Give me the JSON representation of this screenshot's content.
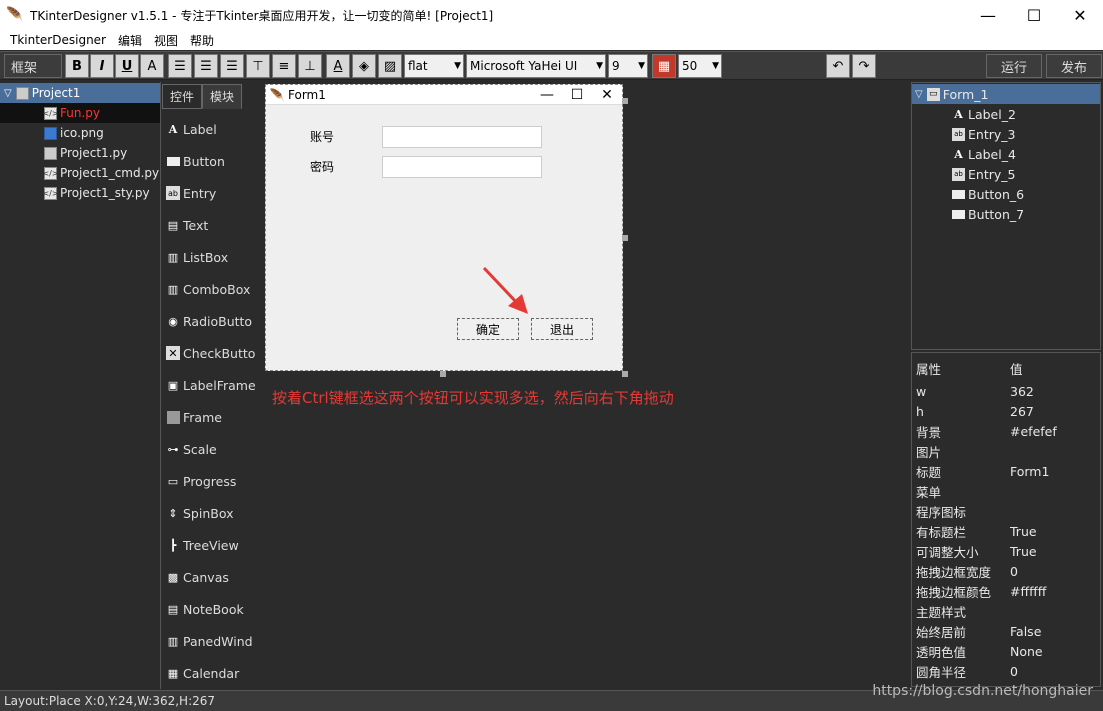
{
  "window": {
    "title": "TKinterDesigner v1.5.1 - 专注于Tkinter桌面应用开发，让一切变的简单!    [Project1]",
    "minimize": "—",
    "maximize": "☐",
    "close": "✕"
  },
  "menu": [
    "TkinterDesigner",
    "编辑",
    "视图",
    "帮助"
  ],
  "toolbar": {
    "frame_label": "框架",
    "bold": "B",
    "italic": "I",
    "underline": "U",
    "font_color": "A",
    "relief": "flat",
    "font_family": "Microsoft YaHei UI",
    "font_size": "9",
    "grid_size": "50",
    "run_label": "运行",
    "publish_label": "发布"
  },
  "project_tree": [
    {
      "label": "Project1",
      "type": "root"
    },
    {
      "label": "Fun.py",
      "type": "py",
      "selected": true
    },
    {
      "label": "ico.png",
      "type": "img"
    },
    {
      "label": "Project1.py",
      "type": "win"
    },
    {
      "label": "Project1_cmd.py",
      "type": "py"
    },
    {
      "label": "Project1_sty.py",
      "type": "py"
    }
  ],
  "palette": {
    "tabs": [
      "控件",
      "模块"
    ],
    "items": [
      "Label",
      "Button",
      "Entry",
      "Text",
      "ListBox",
      "ComboBox",
      "RadioButto",
      "CheckButto",
      "LabelFrame",
      "Frame",
      "Scale",
      "Progress",
      "SpinBox",
      "TreeView",
      "Canvas",
      "NoteBook",
      "PanedWind",
      "Calendar"
    ]
  },
  "form": {
    "title": "Form1",
    "account_label": "账号",
    "password_label": "密码",
    "ok_button": "确定",
    "exit_button": "退出"
  },
  "annotation": "按着Ctrl键框选这两个按钮可以实现多选，然后向右下角拖动",
  "widget_tree": {
    "root": "Form_1",
    "children": [
      "Label_2",
      "Entry_3",
      "Label_4",
      "Entry_5",
      "Button_6",
      "Button_7"
    ]
  },
  "properties": {
    "header_key": "属性",
    "header_value": "值",
    "rows": [
      {
        "k": "w",
        "v": "362"
      },
      {
        "k": "h",
        "v": "267"
      },
      {
        "k": "背景",
        "v": "#efefef"
      },
      {
        "k": "图片",
        "v": ""
      },
      {
        "k": "标题",
        "v": "Form1"
      },
      {
        "k": "菜单",
        "v": ""
      },
      {
        "k": "程序图标",
        "v": ""
      },
      {
        "k": "有标题栏",
        "v": "True"
      },
      {
        "k": "可调整大小",
        "v": "True"
      },
      {
        "k": "拖拽边框宽度",
        "v": "0"
      },
      {
        "k": "拖拽边框颜色",
        "v": "#ffffff"
      },
      {
        "k": "主题样式",
        "v": ""
      },
      {
        "k": "始终居前",
        "v": "False"
      },
      {
        "k": "透明色值",
        "v": "None"
      },
      {
        "k": "圆角半径",
        "v": "0"
      }
    ]
  },
  "status": "Layout:Place  X:0,Y:24,W:362,H:267",
  "watermark": "https://blog.csdn.net/honghaier",
  "colors": {
    "accent": "#4a6e9a",
    "annotation": "#e53935",
    "form_bg": "#efefef"
  }
}
